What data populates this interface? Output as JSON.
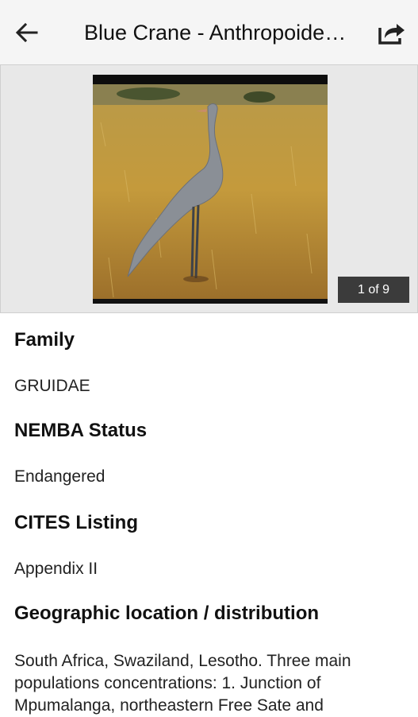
{
  "app_bar": {
    "title": "Blue Crane - Anthropoides paradiseus",
    "back_icon": "arrow-left-icon",
    "share_icon": "share-icon"
  },
  "gallery": {
    "counter": "1 of 9"
  },
  "details": {
    "family_heading": "Family",
    "family_value": "GRUIDAE",
    "nemba_heading": "NEMBA Status",
    "nemba_value": "Endangered",
    "cites_heading": "CITES Listing",
    "cites_value": "Appendix II",
    "geo_heading": "Geographic location / distribution",
    "geo_value": "South Africa, Swaziland, Lesotho. Three main populations concentrations: 1. Junction of Mpumalanga, northeastern Free Sate and"
  }
}
